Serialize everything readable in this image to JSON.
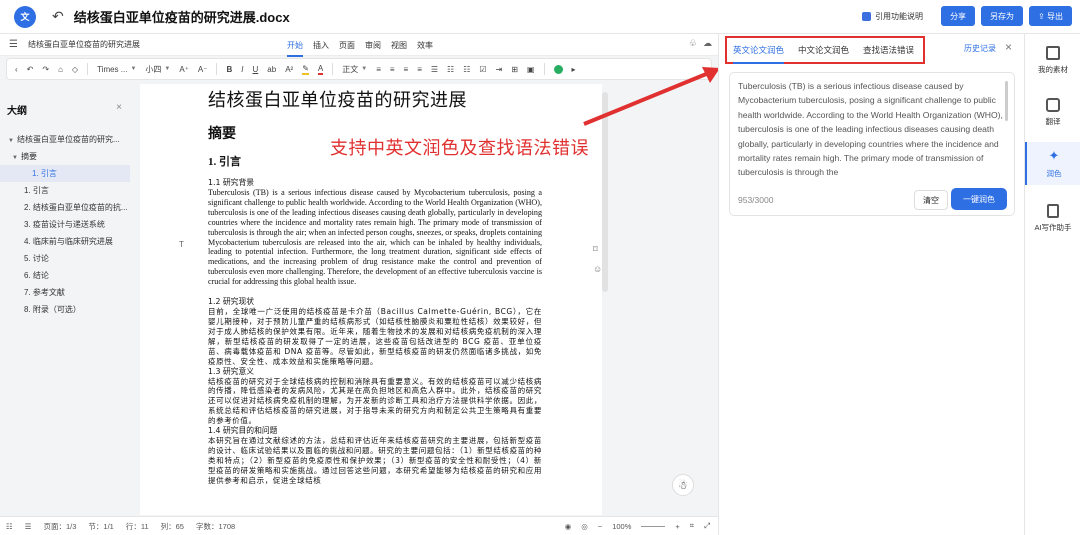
{
  "topbar": {
    "title": "结核蛋白亚单位疫苗的研究进展.docx",
    "cite_label": "引用功能说明",
    "share": "分享",
    "save_as": "另存为",
    "export": "导出"
  },
  "menubar": {
    "doc_title": "结核蛋白亚单位疫苗的研究进展",
    "tabs": [
      "开始",
      "插入",
      "页面",
      "审阅",
      "视图",
      "效率"
    ]
  },
  "toolbar": {
    "font": "Times ...",
    "size": "小四",
    "style": "正文"
  },
  "outline": {
    "title": "大纲",
    "items": [
      "结核蛋白亚单位疫苗的研究...",
      "摘要",
      "1. 引言",
      "1. 引言",
      "2. 结核蛋白亚单位疫苗的抗...",
      "3. 疫苗设计与递送系统",
      "4. 临床前与临床研究进展",
      "5. 讨论",
      "6. 结论",
      "7. 参考文献",
      "8. 附录（可选）"
    ]
  },
  "document": {
    "title": "结核蛋白亚单位疫苗的研究进展",
    "abstract_heading": "摘要",
    "intro_heading": "1.  引言",
    "s1_heading": "1.1 研究背景",
    "s1_text": "Tuberculosis (TB) is a serious infectious disease caused by Mycobacterium tuberculosis, posing a significant challenge to public health worldwide. According to the World Health Organization (WHO), tuberculosis is one of the leading infectious diseases causing death globally, particularly in developing countries where the incidence and mortality rates remain high. The primary mode of transmission of tuberculosis is through the air; when an infected person coughs, sneezes, or speaks, droplets containing Mycobacterium tuberculosis are released into the air, which can be inhaled by healthy individuals, leading to potential infection. Furthermore, the long treatment duration, significant side effects of medications, and the increasing problem of drug resistance make the control and prevention of tuberculosis even more challenging. Therefore, the development of an effective tuberculosis vaccine is crucial for addressing this global health issue.",
    "s2_heading": "1.2 研究现状",
    "s2_text": "目前，全球唯一广泛使用的结核疫苗是卡介苗（Bacillus Calmette-Guérin, BCG），它在婴儿期接种，对于预防儿童严重的结核病形式（如结核性脑膜炎和粟粒性结核）效果较好，但对于成人肺结核的保护效果有限。近年来，随着生物技术的发展和对结核病免疫机制的深入理解，新型结核疫苗的研发取得了一定的进展，这些疫苗包括改进型的 BCG 疫苗、亚单位疫苗、病毒载体疫苗和 DNA 疫苗等。尽管如此，新型结核疫苗的研发仍然面临诸多挑战，如免疫原性、安全性、成本效益和实施策略等问题。",
    "s3_heading": "1.3 研究意义",
    "s3_text": "结核疫苗的研究对于全球结核病的控制和消除具有重要意义。有效的结核疫苗可以减少结核病的传播，降低感染者的发病风险，尤其是在高负担地区和高危人群中。此外，结核疫苗的研究还可以促进对结核病免疫机制的理解，为开发新的诊断工具和治疗方法提供科学依据。因此，系统总结和评估结核疫苗的研究进展，对于指导未来的研究方向和制定公共卫生策略具有重要的参考价值。",
    "s4_heading": "1.4 研究目的和问题",
    "s4_text": "本研究旨在通过文献综述的方法，总结和评估近年来结核疫苗研究的主要进展，包括新型疫苗的设计、临床试验结果以及面临的挑战和问题。研究的主要问题包括：（1）新型结核疫苗的种类和特点；（2）新型疫苗的免疫原性和保护效果；（3）新型疫苗的安全性和耐受性；（4）新型疫苗的研发策略和实施挑战。通过回答这些问题，本研究希望能够为结核疫苗的研究和应用提供参考和启示，促进全球结核"
  },
  "annotation": "支持中英文润色及查找语法错误",
  "statusbar": {
    "page": "页面：1/3",
    "section": "节：1/1",
    "row": "行：11",
    "col": "列：65",
    "words": "字数：1708",
    "zoom": "100%"
  },
  "right_panel": {
    "tabs": [
      "英文论文润色",
      "中文论文润色",
      "查找语法错误"
    ],
    "history": "历史记录",
    "input_text": "Tuberculosis (TB) is a serious infectious disease caused by Mycobacterium tuberculosis, posing a significant challenge to public health worldwide. According to the World Health Organization (WHO), tuberculosis is one of the leading infectious diseases causing death globally, particularly in developing countries where the incidence and mortality rates remain high. The primary mode of transmission of tuberculosis is through the",
    "count": "953/3000",
    "clear": "清空",
    "polish": "一键润色"
  },
  "right_toolbar": {
    "items": [
      "我的素材",
      "翻译",
      "润色",
      "AI写作助手"
    ]
  }
}
